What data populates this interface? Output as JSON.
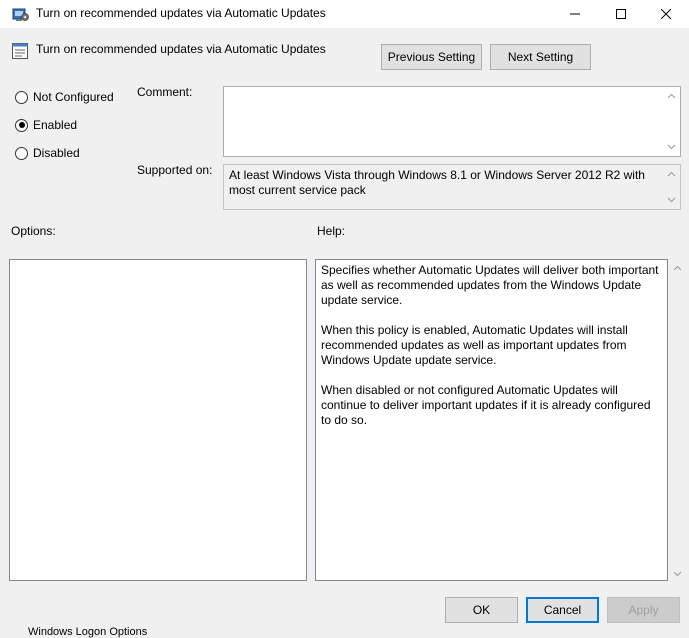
{
  "window": {
    "title": "Turn on recommended updates via Automatic Updates",
    "icon": "policy-settings-icon",
    "controls": [
      "minimize-icon",
      "maximize-icon",
      "close-icon"
    ]
  },
  "header": {
    "policy_title": "Turn on recommended updates via Automatic Updates",
    "previous_button": "Previous Setting",
    "next_button": "Next Setting"
  },
  "state": {
    "options": [
      {
        "label": "Not Configured",
        "checked": false
      },
      {
        "label": "Enabled",
        "checked": true
      },
      {
        "label": "Disabled",
        "checked": false
      }
    ]
  },
  "comment": {
    "label": "Comment:",
    "value": ""
  },
  "supported": {
    "label": "Supported on:",
    "value": "At least Windows Vista through Windows 8.1 or Windows Server 2012 R2 with most current service pack"
  },
  "options_section": {
    "label": "Options:"
  },
  "help_section": {
    "label": "Help:",
    "paragraphs": [
      "Specifies whether Automatic Updates will deliver both important as well as recommended updates from the Windows Update update service.",
      "When this policy is enabled, Automatic Updates will install recommended updates as well as important updates from Windows Update update service.",
      "When disabled or not configured Automatic Updates will continue to deliver important updates if it is already configured to do so."
    ]
  },
  "footer": {
    "ok": "OK",
    "cancel": "Cancel",
    "apply": "Apply"
  },
  "background_text": "Windows Logon Options",
  "colors": {
    "accent": "#0078d7",
    "window_bg": "#f0f0f0"
  }
}
